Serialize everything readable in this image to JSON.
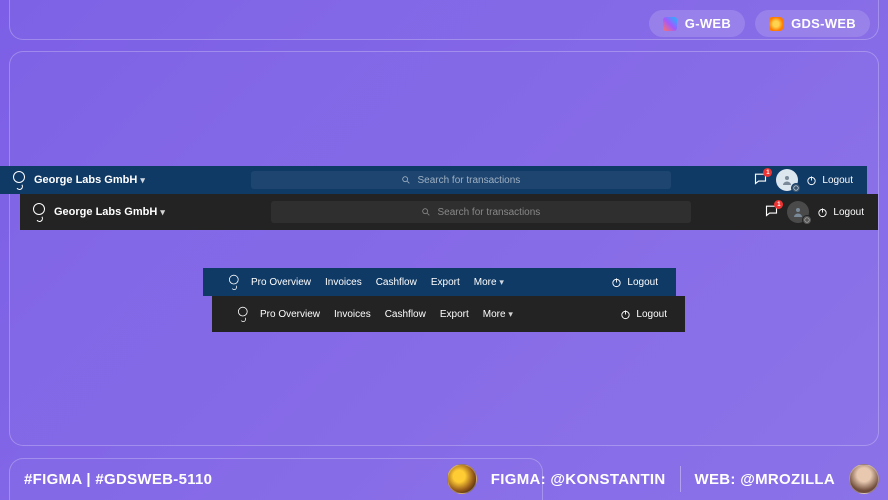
{
  "chips": {
    "gweb": "G-WEB",
    "gdsweb": "GDS-WEB"
  },
  "header": {
    "company": "George Labs GmbH",
    "search_placeholder": "Search for transactions",
    "notification_count": "1",
    "logout": "Logout"
  },
  "nav": {
    "pro_overview": "Pro Overview",
    "invoices": "Invoices",
    "cashflow": "Cashflow",
    "export": "Export",
    "more": "More",
    "logout": "Logout"
  },
  "footer": {
    "tags": "#FIGMA | #GDSWEB-5110"
  },
  "credits": {
    "figma_label": "FIGMA: @KONSTANTIN",
    "web_label": "WEB: @MROZILLA"
  }
}
